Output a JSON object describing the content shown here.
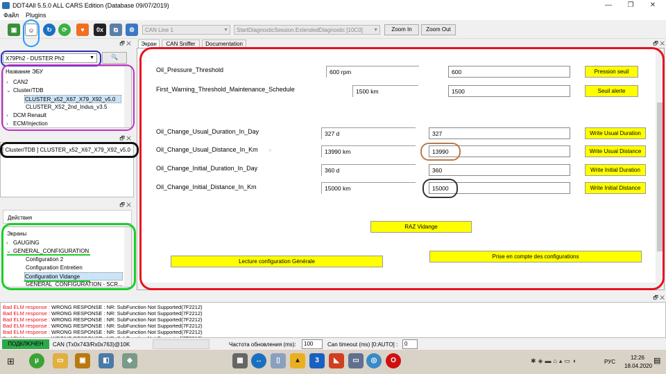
{
  "window": {
    "title": "DDT4All 5.5.0 ALL CARS Edition (Database 09/07/2019)",
    "controls": [
      "—",
      "❐",
      "✕"
    ]
  },
  "menu": [
    "Файл",
    "Plugins"
  ],
  "toolbar": {
    "can_line": "CAN Line 1",
    "session": "StartDiagnosticSession.ExtendedDiagnostic [10C0]",
    "zoom_in": "Zoom In",
    "zoom_out": "Zoom Out",
    "hex_label": "0x"
  },
  "vehicle_select": "X79Ph2 - DUSTER Ph2",
  "ecu_tree": {
    "header": "Название ЭБУ",
    "items": [
      {
        "label": "CAN2",
        "level": 0,
        "expander": "›"
      },
      {
        "label": "Cluster/TDB",
        "level": 0,
        "expander": "⌄"
      },
      {
        "label": "CLUSTER_x52_X67_X79_X92_v5.0",
        "level": 1,
        "selected": true
      },
      {
        "label": "CLUSTER_X52_2nd_Indus_v3.5",
        "level": 1
      },
      {
        "label": "DCM Renault",
        "level": 0,
        "expander": "›"
      },
      {
        "label": "ECM/Injection",
        "level": 0,
        "expander": "›"
      }
    ]
  },
  "selected_ecu": "[ Cluster/TDB ] CLUSTER_x52_X67_X79_X92_v5.0",
  "actions_header": "Действия",
  "screens_tree": {
    "header": "Экраны",
    "items": [
      {
        "label": "GAUGING",
        "level": 0,
        "expander": "›"
      },
      {
        "label": "GENERAL_CONFIGURATION",
        "level": 0,
        "expander": "⌄"
      },
      {
        "label": "Configuration 2",
        "level": 1
      },
      {
        "label": "Configuration Entretien",
        "level": 1
      },
      {
        "label": "Configuration Vidange",
        "level": 1,
        "selected": true
      },
      {
        "label": "GENERAL_CONFIGURATION - SCR...",
        "level": 1
      }
    ]
  },
  "tabs": [
    "Экран",
    "CAN Sniffer",
    "Documentation"
  ],
  "params": [
    {
      "label": "Oil_Pressure_Threshold",
      "value": "600 rpm",
      "input": "600",
      "button": "Pression seuil"
    },
    {
      "label": "First_Warning_Threshold_Maintenance_Schedule",
      "value": "1500 km",
      "input": "1500",
      "button": "Seuil alerte"
    },
    {
      "label": "Oil_Change_Usual_Duration_In_Day",
      "value": "327 d",
      "input": "327",
      "button": "Write Usual Duration"
    },
    {
      "label": "Oil_Change_Usual_Distance_In_Km",
      "value": "13990 km",
      "input": "13990",
      "button": "Write Usual Distance"
    },
    {
      "label": "Oil_Change_Initial_Duration_In_Day",
      "value": "360 d",
      "input": "360",
      "button": "Write Initial Duration"
    },
    {
      "label": "Oil_Change_Initial_Distance_In_Km",
      "value": "15000 km",
      "input": "15000",
      "button": "Write Initial Distance"
    }
  ],
  "buttons": {
    "raz": "RAZ Vidange",
    "lecture": "Lecture configuration G‌énérale",
    "prise": "Prise en compte des configurations"
  },
  "log": {
    "prefix": "Bad ELM response :",
    "message": " WRONG RESPONSE : NR: SubFunction Not Supported(7F2212)",
    "lines": 6
  },
  "statusbar": {
    "connection": "ПОДКЛЮЧЕН",
    "can_info": "CAN (Tx0x743/Rx0x763)@10K",
    "refresh_label": "Частота обновления (ms):",
    "refresh_value": "100",
    "timeout_label": "Can timeout (ms) [0:AUTO] :",
    "timeout_value": "0"
  },
  "taskbar": {
    "lang": "РУС",
    "time": "12:26",
    "date": "18.04.2020"
  },
  "colors": {
    "red": "#e8101e",
    "blue": "#1e9bff",
    "purple": "#c030c8",
    "green": "#1dcc2a",
    "black": "#111111",
    "brown": "#b87a4a",
    "yellow": "#ffff00"
  }
}
